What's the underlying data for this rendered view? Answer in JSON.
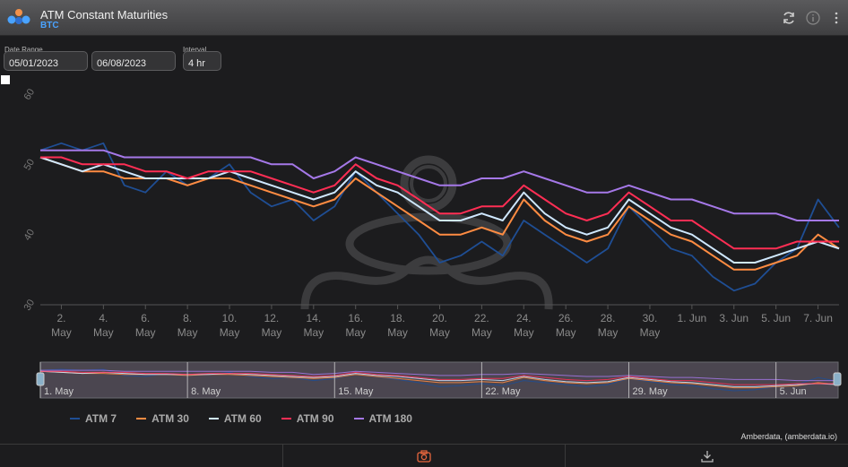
{
  "header": {
    "title": "ATM Constant Maturities",
    "subtitle": "BTC",
    "refresh_icon": "refresh-icon",
    "info_icon": "info-icon",
    "menu_icon": "more-vertical-icon"
  },
  "controls": {
    "date_range_label": "Date Range",
    "start_date": "05/01/2023",
    "end_date": "06/08/2023",
    "interval_label": "Interval",
    "interval": "4 hr"
  },
  "colors": {
    "ATM 7": "#1f4e94",
    "ATM 30": "#ff8c42",
    "ATM 60": "#cfe8ff",
    "ATM 90": "#ff2e54",
    "ATM 180": "#a578e8"
  },
  "chart_data": {
    "type": "line",
    "x_unit": "date (2023)",
    "x_ticks": [
      {
        "date": "2023-05-02",
        "label": [
          "2.",
          "May"
        ]
      },
      {
        "date": "2023-05-04",
        "label": [
          "4.",
          "May"
        ]
      },
      {
        "date": "2023-05-06",
        "label": [
          "6.",
          "May"
        ]
      },
      {
        "date": "2023-05-08",
        "label": [
          "8.",
          "May"
        ]
      },
      {
        "date": "2023-05-10",
        "label": [
          "10.",
          "May"
        ]
      },
      {
        "date": "2023-05-12",
        "label": [
          "12.",
          "May"
        ]
      },
      {
        "date": "2023-05-14",
        "label": [
          "14.",
          "May"
        ]
      },
      {
        "date": "2023-05-16",
        "label": [
          "16.",
          "May"
        ]
      },
      {
        "date": "2023-05-18",
        "label": [
          "18.",
          "May"
        ]
      },
      {
        "date": "2023-05-20",
        "label": [
          "20.",
          "May"
        ]
      },
      {
        "date": "2023-05-22",
        "label": [
          "22.",
          "May"
        ]
      },
      {
        "date": "2023-05-24",
        "label": [
          "24.",
          "May"
        ]
      },
      {
        "date": "2023-05-26",
        "label": [
          "26.",
          "May"
        ]
      },
      {
        "date": "2023-05-28",
        "label": [
          "28.",
          "May"
        ]
      },
      {
        "date": "2023-05-30",
        "label": [
          "30.",
          "May"
        ]
      },
      {
        "date": "2023-06-01",
        "label": [
          "1. Jun"
        ]
      },
      {
        "date": "2023-06-03",
        "label": [
          "3. Jun"
        ]
      },
      {
        "date": "2023-06-05",
        "label": [
          "5. Jun"
        ]
      },
      {
        "date": "2023-06-07",
        "label": [
          "7. Jun"
        ]
      }
    ],
    "y_ticks": [
      30,
      40,
      50,
      60
    ],
    "ylim": [
      30,
      60
    ],
    "xlim": [
      "2023-05-01",
      "2023-06-08"
    ],
    "grid": false,
    "legend_position": "bottom-left",
    "series": [
      {
        "name": "ATM 7",
        "points": [
          [
            "2023-05-01",
            52
          ],
          [
            "2023-05-02",
            53
          ],
          [
            "2023-05-03",
            52
          ],
          [
            "2023-05-04",
            53
          ],
          [
            "2023-05-05",
            47
          ],
          [
            "2023-05-06",
            46
          ],
          [
            "2023-05-07",
            49
          ],
          [
            "2023-05-08",
            47
          ],
          [
            "2023-05-09",
            48
          ],
          [
            "2023-05-10",
            50
          ],
          [
            "2023-05-11",
            46
          ],
          [
            "2023-05-12",
            44
          ],
          [
            "2023-05-13",
            45
          ],
          [
            "2023-05-14",
            42
          ],
          [
            "2023-05-15",
            44
          ],
          [
            "2023-05-16",
            49
          ],
          [
            "2023-05-17",
            46
          ],
          [
            "2023-05-18",
            43
          ],
          [
            "2023-05-19",
            40
          ],
          [
            "2023-05-20",
            36
          ],
          [
            "2023-05-21",
            37
          ],
          [
            "2023-05-22",
            39
          ],
          [
            "2023-05-23",
            37
          ],
          [
            "2023-05-24",
            42
          ],
          [
            "2023-05-25",
            40
          ],
          [
            "2023-05-26",
            38
          ],
          [
            "2023-05-27",
            36
          ],
          [
            "2023-05-28",
            38
          ],
          [
            "2023-05-29",
            44
          ],
          [
            "2023-05-30",
            41
          ],
          [
            "2023-05-31",
            38
          ],
          [
            "2023-06-01",
            37
          ],
          [
            "2023-06-02",
            34
          ],
          [
            "2023-06-03",
            32
          ],
          [
            "2023-06-04",
            33
          ],
          [
            "2023-06-05",
            36
          ],
          [
            "2023-06-06",
            38
          ],
          [
            "2023-06-07",
            45
          ],
          [
            "2023-06-08",
            41
          ]
        ]
      },
      {
        "name": "ATM 30",
        "points": [
          [
            "2023-05-01",
            51
          ],
          [
            "2023-05-02",
            50
          ],
          [
            "2023-05-03",
            49
          ],
          [
            "2023-05-04",
            49
          ],
          [
            "2023-05-05",
            48
          ],
          [
            "2023-05-06",
            48
          ],
          [
            "2023-05-07",
            48
          ],
          [
            "2023-05-08",
            47
          ],
          [
            "2023-05-09",
            48
          ],
          [
            "2023-05-10",
            48
          ],
          [
            "2023-05-11",
            47
          ],
          [
            "2023-05-12",
            46
          ],
          [
            "2023-05-13",
            45
          ],
          [
            "2023-05-14",
            44
          ],
          [
            "2023-05-15",
            45
          ],
          [
            "2023-05-16",
            48
          ],
          [
            "2023-05-17",
            46
          ],
          [
            "2023-05-18",
            44
          ],
          [
            "2023-05-19",
            42
          ],
          [
            "2023-05-20",
            40
          ],
          [
            "2023-05-21",
            40
          ],
          [
            "2023-05-22",
            41
          ],
          [
            "2023-05-23",
            40
          ],
          [
            "2023-05-24",
            45
          ],
          [
            "2023-05-25",
            42
          ],
          [
            "2023-05-26",
            40
          ],
          [
            "2023-05-27",
            39
          ],
          [
            "2023-05-28",
            40
          ],
          [
            "2023-05-29",
            44
          ],
          [
            "2023-05-30",
            42
          ],
          [
            "2023-05-31",
            40
          ],
          [
            "2023-06-01",
            39
          ],
          [
            "2023-06-02",
            37
          ],
          [
            "2023-06-03",
            35
          ],
          [
            "2023-06-04",
            35
          ],
          [
            "2023-06-05",
            36
          ],
          [
            "2023-06-06",
            37
          ],
          [
            "2023-06-07",
            40
          ],
          [
            "2023-06-08",
            38
          ]
        ]
      },
      {
        "name": "ATM 60",
        "points": [
          [
            "2023-05-01",
            51
          ],
          [
            "2023-05-02",
            50
          ],
          [
            "2023-05-03",
            49
          ],
          [
            "2023-05-04",
            50
          ],
          [
            "2023-05-05",
            49
          ],
          [
            "2023-05-06",
            48
          ],
          [
            "2023-05-07",
            48
          ],
          [
            "2023-05-08",
            48
          ],
          [
            "2023-05-09",
            48
          ],
          [
            "2023-05-10",
            49
          ],
          [
            "2023-05-11",
            48
          ],
          [
            "2023-05-12",
            47
          ],
          [
            "2023-05-13",
            46
          ],
          [
            "2023-05-14",
            45
          ],
          [
            "2023-05-15",
            46
          ],
          [
            "2023-05-16",
            49
          ],
          [
            "2023-05-17",
            47
          ],
          [
            "2023-05-18",
            46
          ],
          [
            "2023-05-19",
            44
          ],
          [
            "2023-05-20",
            42
          ],
          [
            "2023-05-21",
            42
          ],
          [
            "2023-05-22",
            43
          ],
          [
            "2023-05-23",
            42
          ],
          [
            "2023-05-24",
            46
          ],
          [
            "2023-05-25",
            43
          ],
          [
            "2023-05-26",
            41
          ],
          [
            "2023-05-27",
            40
          ],
          [
            "2023-05-28",
            41
          ],
          [
            "2023-05-29",
            45
          ],
          [
            "2023-05-30",
            43
          ],
          [
            "2023-05-31",
            41
          ],
          [
            "2023-06-01",
            40
          ],
          [
            "2023-06-02",
            38
          ],
          [
            "2023-06-03",
            36
          ],
          [
            "2023-06-04",
            36
          ],
          [
            "2023-06-05",
            37
          ],
          [
            "2023-06-06",
            38
          ],
          [
            "2023-06-07",
            39
          ],
          [
            "2023-06-08",
            38
          ]
        ]
      },
      {
        "name": "ATM 90",
        "points": [
          [
            "2023-05-01",
            51
          ],
          [
            "2023-05-02",
            51
          ],
          [
            "2023-05-03",
            50
          ],
          [
            "2023-05-04",
            50
          ],
          [
            "2023-05-05",
            50
          ],
          [
            "2023-05-06",
            49
          ],
          [
            "2023-05-07",
            49
          ],
          [
            "2023-05-08",
            48
          ],
          [
            "2023-05-09",
            49
          ],
          [
            "2023-05-10",
            49
          ],
          [
            "2023-05-11",
            49
          ],
          [
            "2023-05-12",
            48
          ],
          [
            "2023-05-13",
            47
          ],
          [
            "2023-05-14",
            46
          ],
          [
            "2023-05-15",
            47
          ],
          [
            "2023-05-16",
            50
          ],
          [
            "2023-05-17",
            48
          ],
          [
            "2023-05-18",
            47
          ],
          [
            "2023-05-19",
            45
          ],
          [
            "2023-05-20",
            43
          ],
          [
            "2023-05-21",
            43
          ],
          [
            "2023-05-22",
            44
          ],
          [
            "2023-05-23",
            44
          ],
          [
            "2023-05-24",
            47
          ],
          [
            "2023-05-25",
            45
          ],
          [
            "2023-05-26",
            43
          ],
          [
            "2023-05-27",
            42
          ],
          [
            "2023-05-28",
            43
          ],
          [
            "2023-05-29",
            46
          ],
          [
            "2023-05-30",
            44
          ],
          [
            "2023-05-31",
            42
          ],
          [
            "2023-06-01",
            42
          ],
          [
            "2023-06-02",
            40
          ],
          [
            "2023-06-03",
            38
          ],
          [
            "2023-06-04",
            38
          ],
          [
            "2023-06-05",
            38
          ],
          [
            "2023-06-06",
            39
          ],
          [
            "2023-06-07",
            39
          ],
          [
            "2023-06-08",
            39
          ]
        ]
      },
      {
        "name": "ATM 180",
        "points": [
          [
            "2023-05-01",
            52
          ],
          [
            "2023-05-02",
            52
          ],
          [
            "2023-05-03",
            52
          ],
          [
            "2023-05-04",
            52
          ],
          [
            "2023-05-05",
            51
          ],
          [
            "2023-05-06",
            51
          ],
          [
            "2023-05-07",
            51
          ],
          [
            "2023-05-08",
            51
          ],
          [
            "2023-05-09",
            51
          ],
          [
            "2023-05-10",
            51
          ],
          [
            "2023-05-11",
            51
          ],
          [
            "2023-05-12",
            50
          ],
          [
            "2023-05-13",
            50
          ],
          [
            "2023-05-14",
            48
          ],
          [
            "2023-05-15",
            49
          ],
          [
            "2023-05-16",
            51
          ],
          [
            "2023-05-17",
            50
          ],
          [
            "2023-05-18",
            49
          ],
          [
            "2023-05-19",
            48
          ],
          [
            "2023-05-20",
            47
          ],
          [
            "2023-05-21",
            47
          ],
          [
            "2023-05-22",
            48
          ],
          [
            "2023-05-23",
            48
          ],
          [
            "2023-05-24",
            49
          ],
          [
            "2023-05-25",
            48
          ],
          [
            "2023-05-26",
            47
          ],
          [
            "2023-05-27",
            46
          ],
          [
            "2023-05-28",
            46
          ],
          [
            "2023-05-29",
            47
          ],
          [
            "2023-05-30",
            46
          ],
          [
            "2023-05-31",
            45
          ],
          [
            "2023-06-01",
            45
          ],
          [
            "2023-06-02",
            44
          ],
          [
            "2023-06-03",
            43
          ],
          [
            "2023-06-04",
            43
          ],
          [
            "2023-06-05",
            43
          ],
          [
            "2023-06-06",
            42
          ],
          [
            "2023-06-07",
            42
          ],
          [
            "2023-06-08",
            42
          ]
        ]
      }
    ]
  },
  "navigator": {
    "labels": [
      {
        "date": "2023-05-01",
        "text": "1. May"
      },
      {
        "date": "2023-05-08",
        "text": "8. May"
      },
      {
        "date": "2023-05-15",
        "text": "15. May"
      },
      {
        "date": "2023-05-22",
        "text": "22. May"
      },
      {
        "date": "2023-05-29",
        "text": "29. May"
      },
      {
        "date": "2023-06-05",
        "text": "5. Jun"
      }
    ]
  },
  "credit": "Amberdata, (amberdata.io)",
  "footer": {
    "camera_icon": "camera-icon",
    "download_icon": "download-icon"
  }
}
